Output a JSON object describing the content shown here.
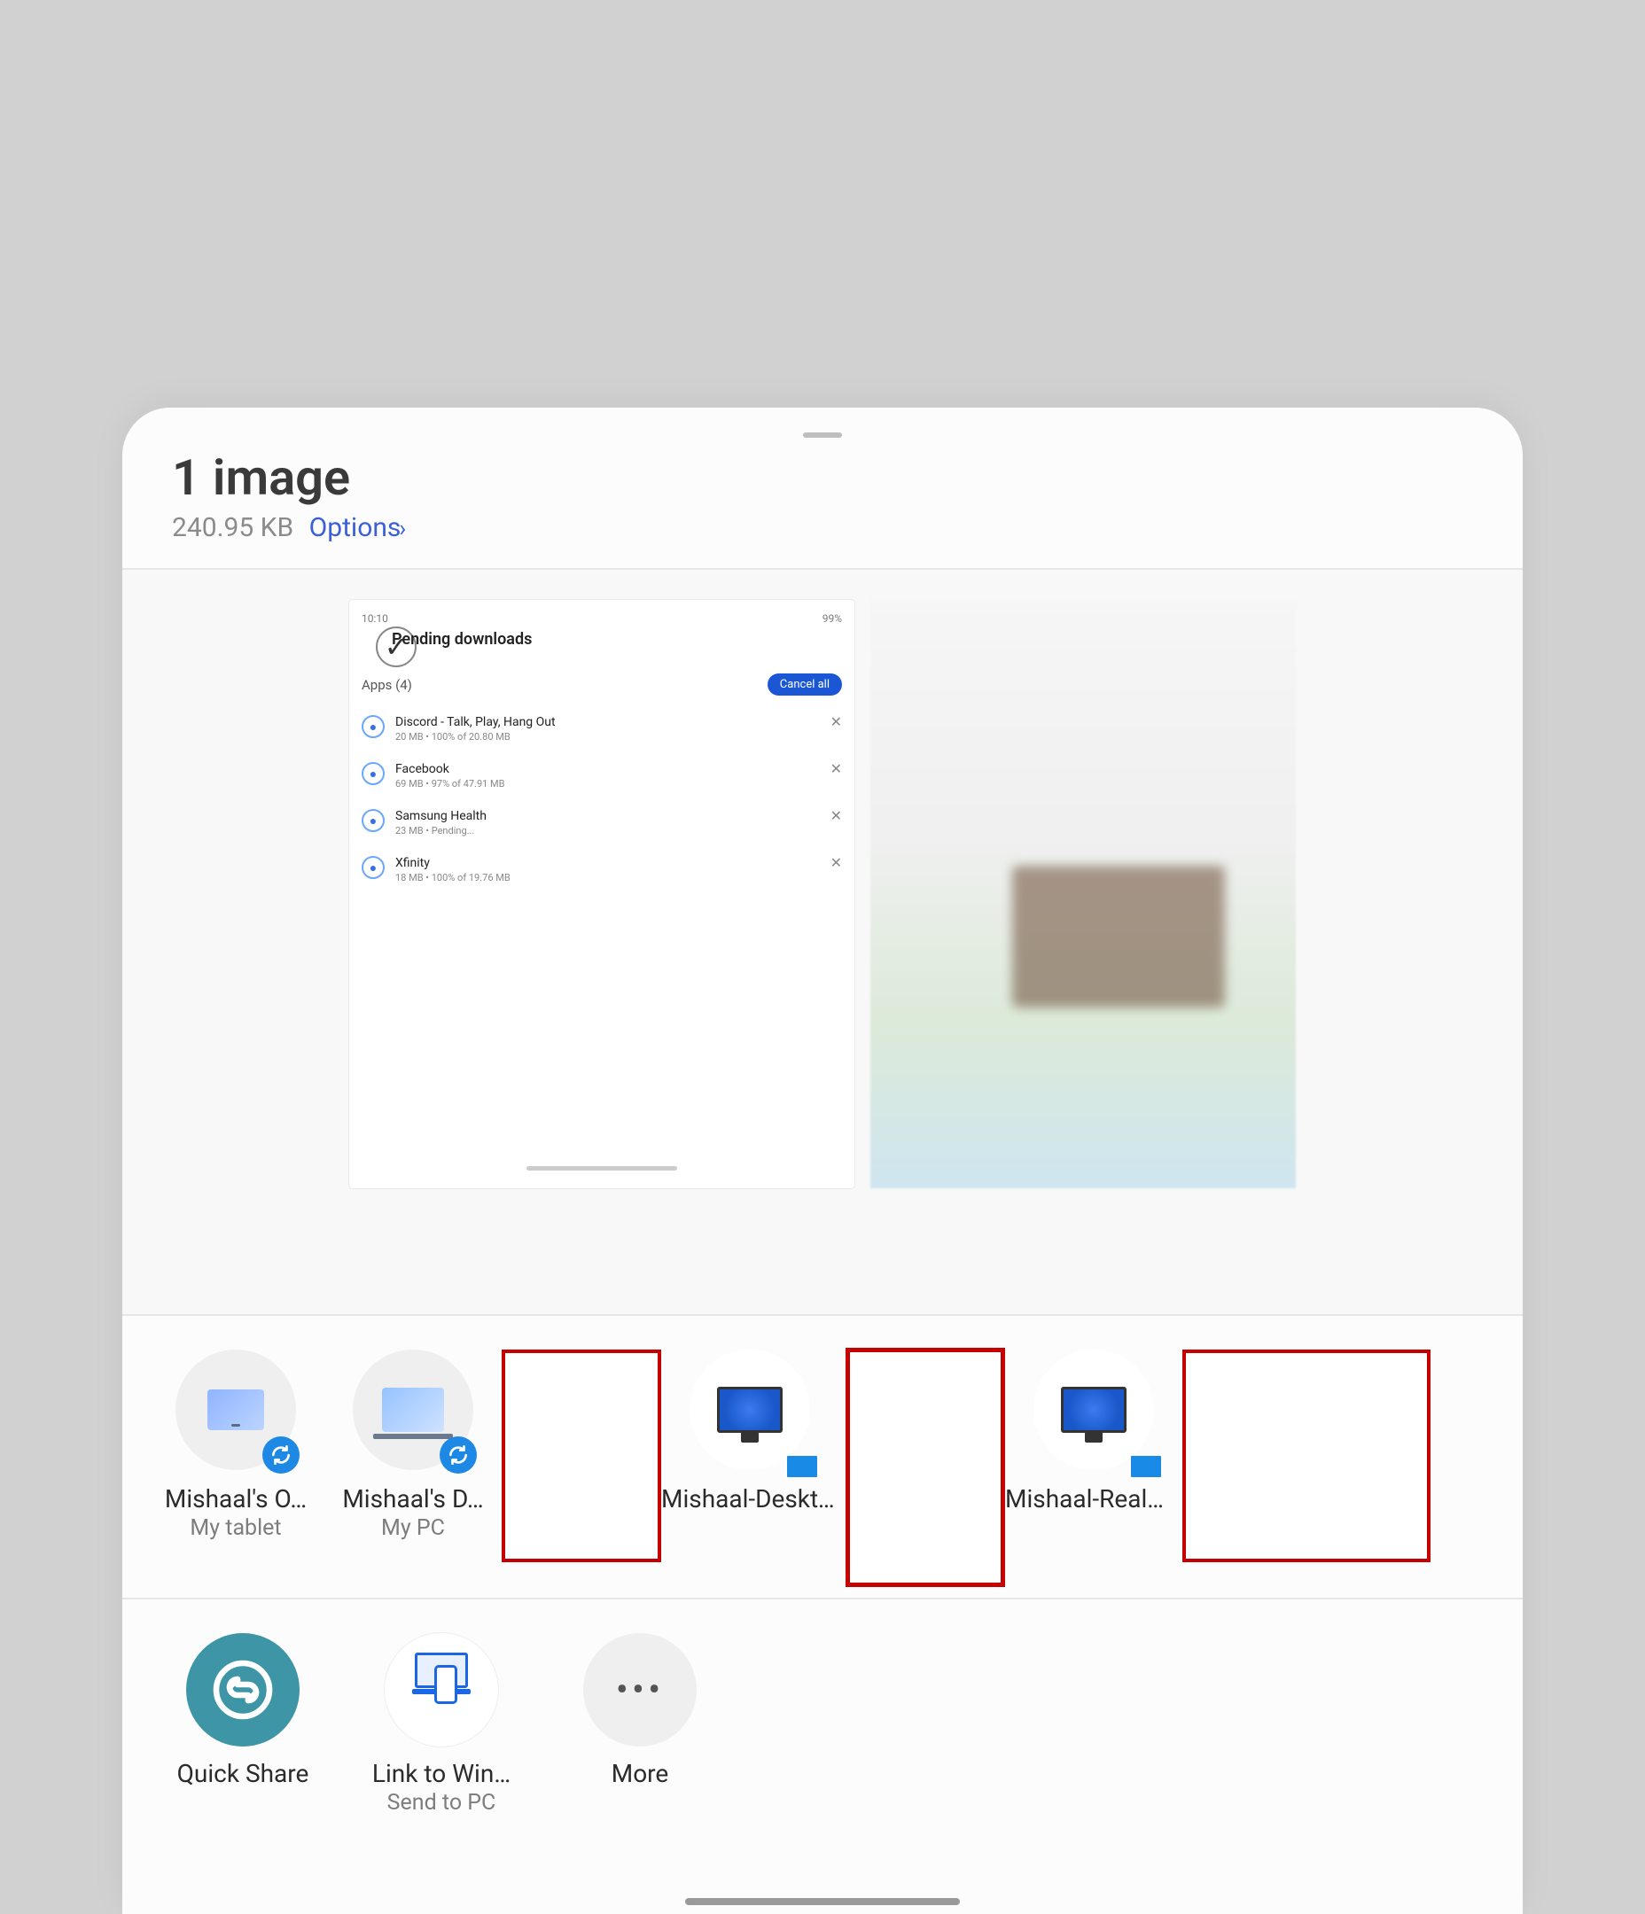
{
  "header": {
    "title": "1 image",
    "size": "240.95 KB",
    "options_label": "Options"
  },
  "thumbnail": {
    "statusbar_left": "10:10",
    "statusbar_right": "99%",
    "screen_title": "Pending downloads",
    "apps_label": "Apps (4)",
    "cancel_all": "Cancel all",
    "apps": [
      {
        "name": "Discord - Talk, Play, Hang Out",
        "sub": "20 MB • 100% of 20.80 MB"
      },
      {
        "name": "Facebook",
        "sub": "69 MB • 97% of 47.91 MB"
      },
      {
        "name": "Samsung Health",
        "sub": "23 MB • Pending..."
      },
      {
        "name": "Xfinity",
        "sub": "18 MB • 100% of 19.76 MB"
      }
    ]
  },
  "targets": [
    {
      "label": "Mishaal's O…",
      "sub": "My tablet",
      "kind": "tablet",
      "sync": true
    },
    {
      "label": "Mishaal's D…",
      "sub": "My PC",
      "kind": "laptop",
      "sync": true
    },
    {
      "redacted": true
    },
    {
      "label": "Mishaal-Desktop",
      "kind": "windows-pc"
    },
    {
      "redacted": true,
      "tall": true
    },
    {
      "label": "Mishaal-Realme-Book",
      "kind": "windows-pc"
    },
    {
      "redacted": true,
      "wide": true
    }
  ],
  "actions": {
    "quick_share": "Quick Share",
    "link_to_windows": "Link to Win…",
    "link_to_windows_sub": "Send to PC",
    "more": "More"
  }
}
